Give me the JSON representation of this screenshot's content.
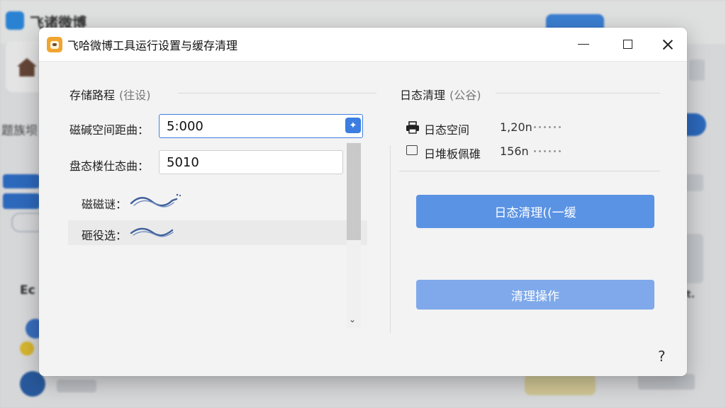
{
  "background": {
    "app_title": "飞诸微博",
    "side_label": "题族坝",
    "ec_text": "Ec",
    "right_text": "t."
  },
  "dialog": {
    "title": "飞哈微博工具运行设置与缓存清理",
    "controls": {
      "minimize": "—",
      "maximize": "☐",
      "close": "✕"
    }
  },
  "storage": {
    "section_title": "存储路程",
    "section_hint": "(往设)",
    "fields": [
      {
        "label": "磁碱空间距曲：",
        "value": "5:000"
      },
      {
        "label": "盘态楼仕态曲：",
        "value": "5010"
      }
    ],
    "options": [
      {
        "label": "磁磁谜："
      },
      {
        "label": "砸役选："
      }
    ],
    "scroll_down": "⌄"
  },
  "log": {
    "section_title": "日态清理",
    "section_hint": "(公谷)",
    "rows": [
      {
        "label": "日态空间",
        "value": "1,20n"
      },
      {
        "label": "日堆板佩碓",
        "value": "156n"
      }
    ],
    "clean_button": "日态清理((一缓",
    "operation_button": "清理操作"
  },
  "help": "?",
  "colors": {
    "accent": "#3d7fdc",
    "primary_button": "#5b93e4",
    "secondary_button": "#7fa9ea",
    "wave": "#3e5f9a"
  }
}
